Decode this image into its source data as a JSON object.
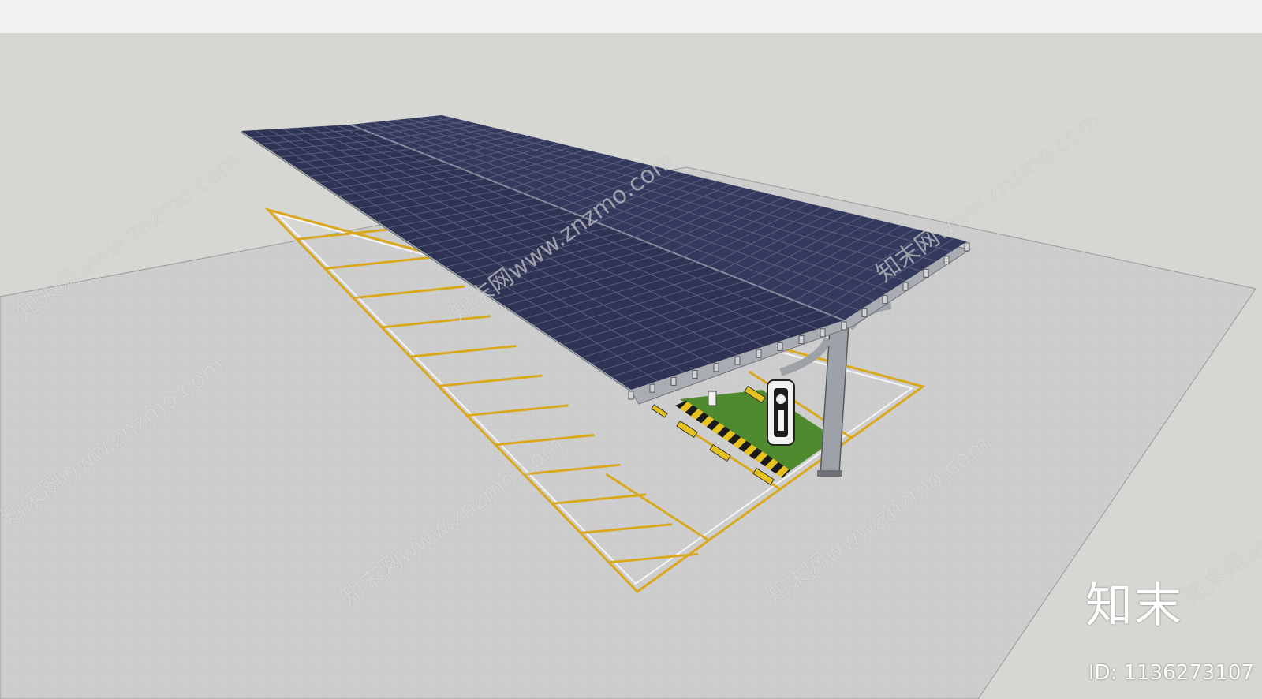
{
  "watermark": {
    "text": "知末网www.znzmo.com"
  },
  "brand": {
    "logo_text": "知末",
    "id_label": "ID: 1136273107"
  },
  "colors": {
    "sky": "#d6d6d2",
    "top_bar": "#f1f1f1",
    "ground": "#cfcfcf",
    "panel": "#2f3354",
    "panel_grid": "#5a607e",
    "frame": "#a9adb3",
    "parking_line": "#d9a81c",
    "grass": "#4f8a2f",
    "hazard_yellow": "#e6c21e"
  }
}
